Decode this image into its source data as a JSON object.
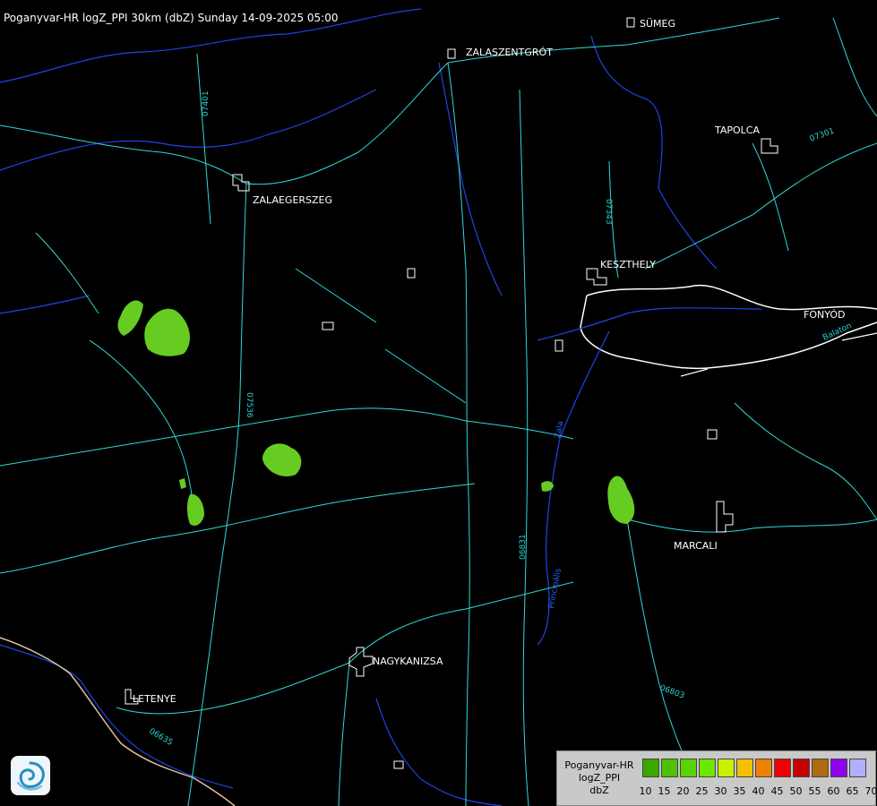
{
  "title": "Poganyvar-HR logZ_PPI 30km (dbZ) Sunday 14-09-2025 05:00",
  "towns": [
    "SÜMEG",
    "ZALASZENTGRÓT",
    "TAPOLCA",
    "ZALAEGERSZEG",
    "KESZTHELY",
    "FONYÓD",
    "MARCALI",
    "NAGYKANIZSA",
    "LETENYE"
  ],
  "road_labels": [
    "07401",
    "07343",
    "07536",
    "06831",
    "06803",
    "06635",
    "07301"
  ],
  "water_labels": [
    "Zala",
    "Principális",
    "Balaton"
  ],
  "legend": {
    "name_lines": [
      "Poganyvar-HR",
      "logZ_PPI",
      "dbZ"
    ],
    "ticks": [
      "10",
      "15",
      "20",
      "25",
      "30",
      "35",
      "40",
      "45",
      "50",
      "55",
      "60",
      "65",
      "70"
    ],
    "colors": [
      "#3aa800",
      "#4fc000",
      "#5ad400",
      "#6ee600",
      "#c8f000",
      "#f4c000",
      "#f08000",
      "#f00000",
      "#c80000",
      "#b06a10",
      "#9000f0",
      "#b0b0ff"
    ]
  },
  "echo_color": "#66cc22"
}
